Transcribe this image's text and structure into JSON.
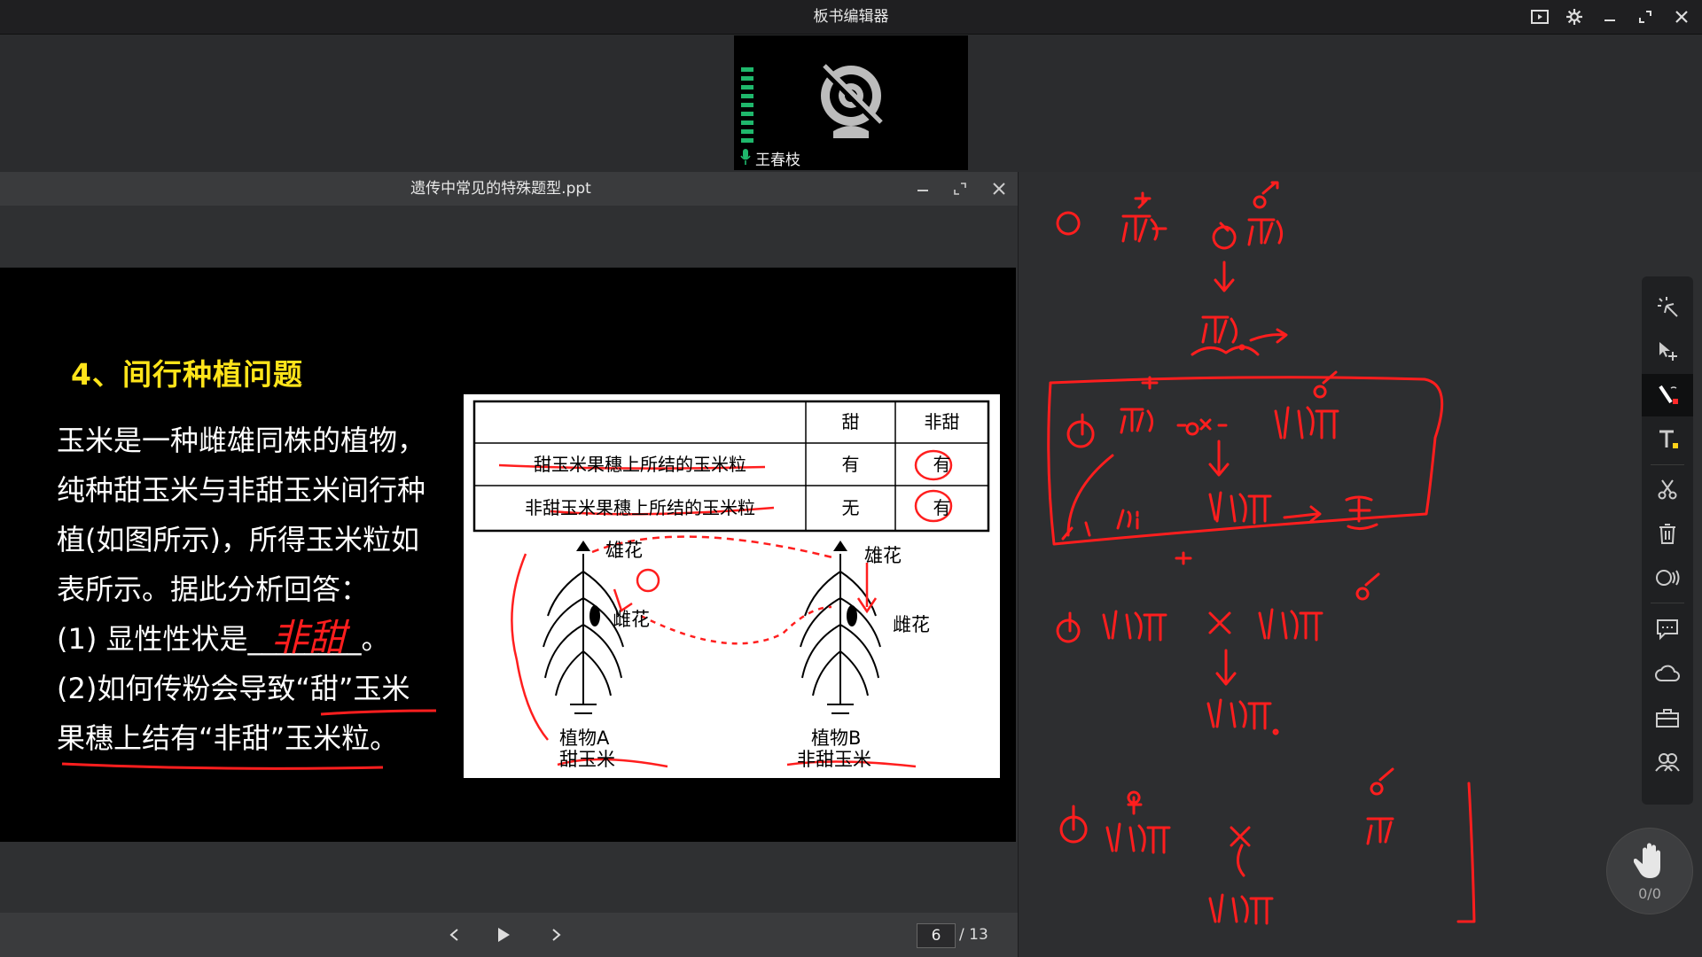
{
  "app": {
    "title": "板书编辑器"
  },
  "camera": {
    "name": "王春枝",
    "mic_level": 0.9
  },
  "ppt": {
    "title": "遗传中常见的特殊题型.ppt",
    "slide": {
      "heading": "4、间行种植问题",
      "lines": [
        "玉米是一种雌雄同株的植物，",
        "纯种甜玉米与非甜玉米间行种",
        "植(如图所示)，所得玉米粒如",
        "表所示。据此分析回答：",
        "(1) 显性性状是________。",
        "(2)如何传粉会导致“甜”玉米",
        "果穗上结有“非甜”玉米粒。"
      ],
      "answer_handwritten": "非甜",
      "table": {
        "headers": [
          "",
          "甜",
          "非甜"
        ],
        "rows": [
          [
            "甜玉米果穗上所结的玉米粒",
            "有",
            "有"
          ],
          [
            "非甜玉米果穗上所结的玉米粒",
            "无",
            "有"
          ]
        ]
      },
      "plant_a": {
        "line1": "植物A",
        "line2": "甜玉米"
      },
      "plant_b": {
        "line1": "植物B",
        "line2": "非甜玉米"
      },
      "labels": {
        "male_flower": "雄花",
        "female_flower": "雌花"
      }
    },
    "current_page": "6",
    "total_pages": "/ 13"
  },
  "toolbar": {
    "hand_count": "0/0"
  },
  "colors": {
    "ink": "#ff1e1e",
    "accent_green": "#1fb86c",
    "heading_yellow": "#ffe41a"
  }
}
